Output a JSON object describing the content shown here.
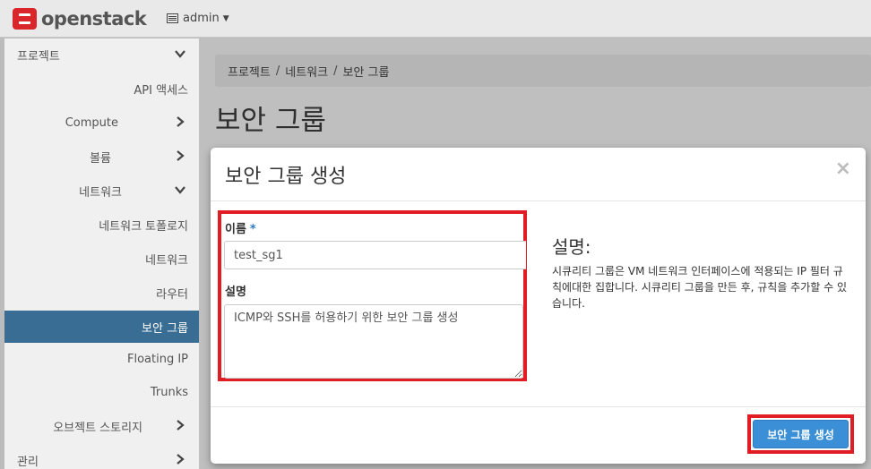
{
  "header": {
    "brand": "openstack",
    "project": "admin"
  },
  "sidebar": {
    "items": [
      {
        "label": "프로젝트"
      },
      {
        "label": "API 액세스"
      },
      {
        "label": "Compute"
      },
      {
        "label": "볼륨"
      },
      {
        "label": "네트워크"
      },
      {
        "label": "네트워크 토폴로지"
      },
      {
        "label": "네트워크"
      },
      {
        "label": "라우터"
      },
      {
        "label": "보안 그룹"
      },
      {
        "label": "Floating IP"
      },
      {
        "label": "Trunks"
      },
      {
        "label": "오브젝트 스토리지"
      },
      {
        "label": "관리"
      }
    ]
  },
  "breadcrumb": {
    "items": [
      "프로젝트",
      "네트워크",
      "보안 그룹"
    ],
    "separator": "/"
  },
  "page": {
    "title": "보안 그룹"
  },
  "modal": {
    "title": "보안 그룹 생성",
    "close_label": "×",
    "form": {
      "name_label": "이름",
      "required_mark": "*",
      "name_value": "test_sg1",
      "description_label": "설명",
      "description_value": "ICMP와 SSH를 허용하기 위한 보안 그룹 생성"
    },
    "help": {
      "title": "설명:",
      "text": "시큐리티 그룹은 VM 네트워크 인터페이스에 적용되는 IP 필터 규칙에대한 집합니다. 시큐리티 그룹을 만든 후, 규칙을 추가할 수 있습니다."
    },
    "submit_label": "보안 그룹 생성"
  },
  "colors": {
    "accent": "#3a6d94",
    "primary_button": "#3a8fd6",
    "highlight_outline": "#e01d25",
    "required_mark": "#2a7bbf"
  }
}
